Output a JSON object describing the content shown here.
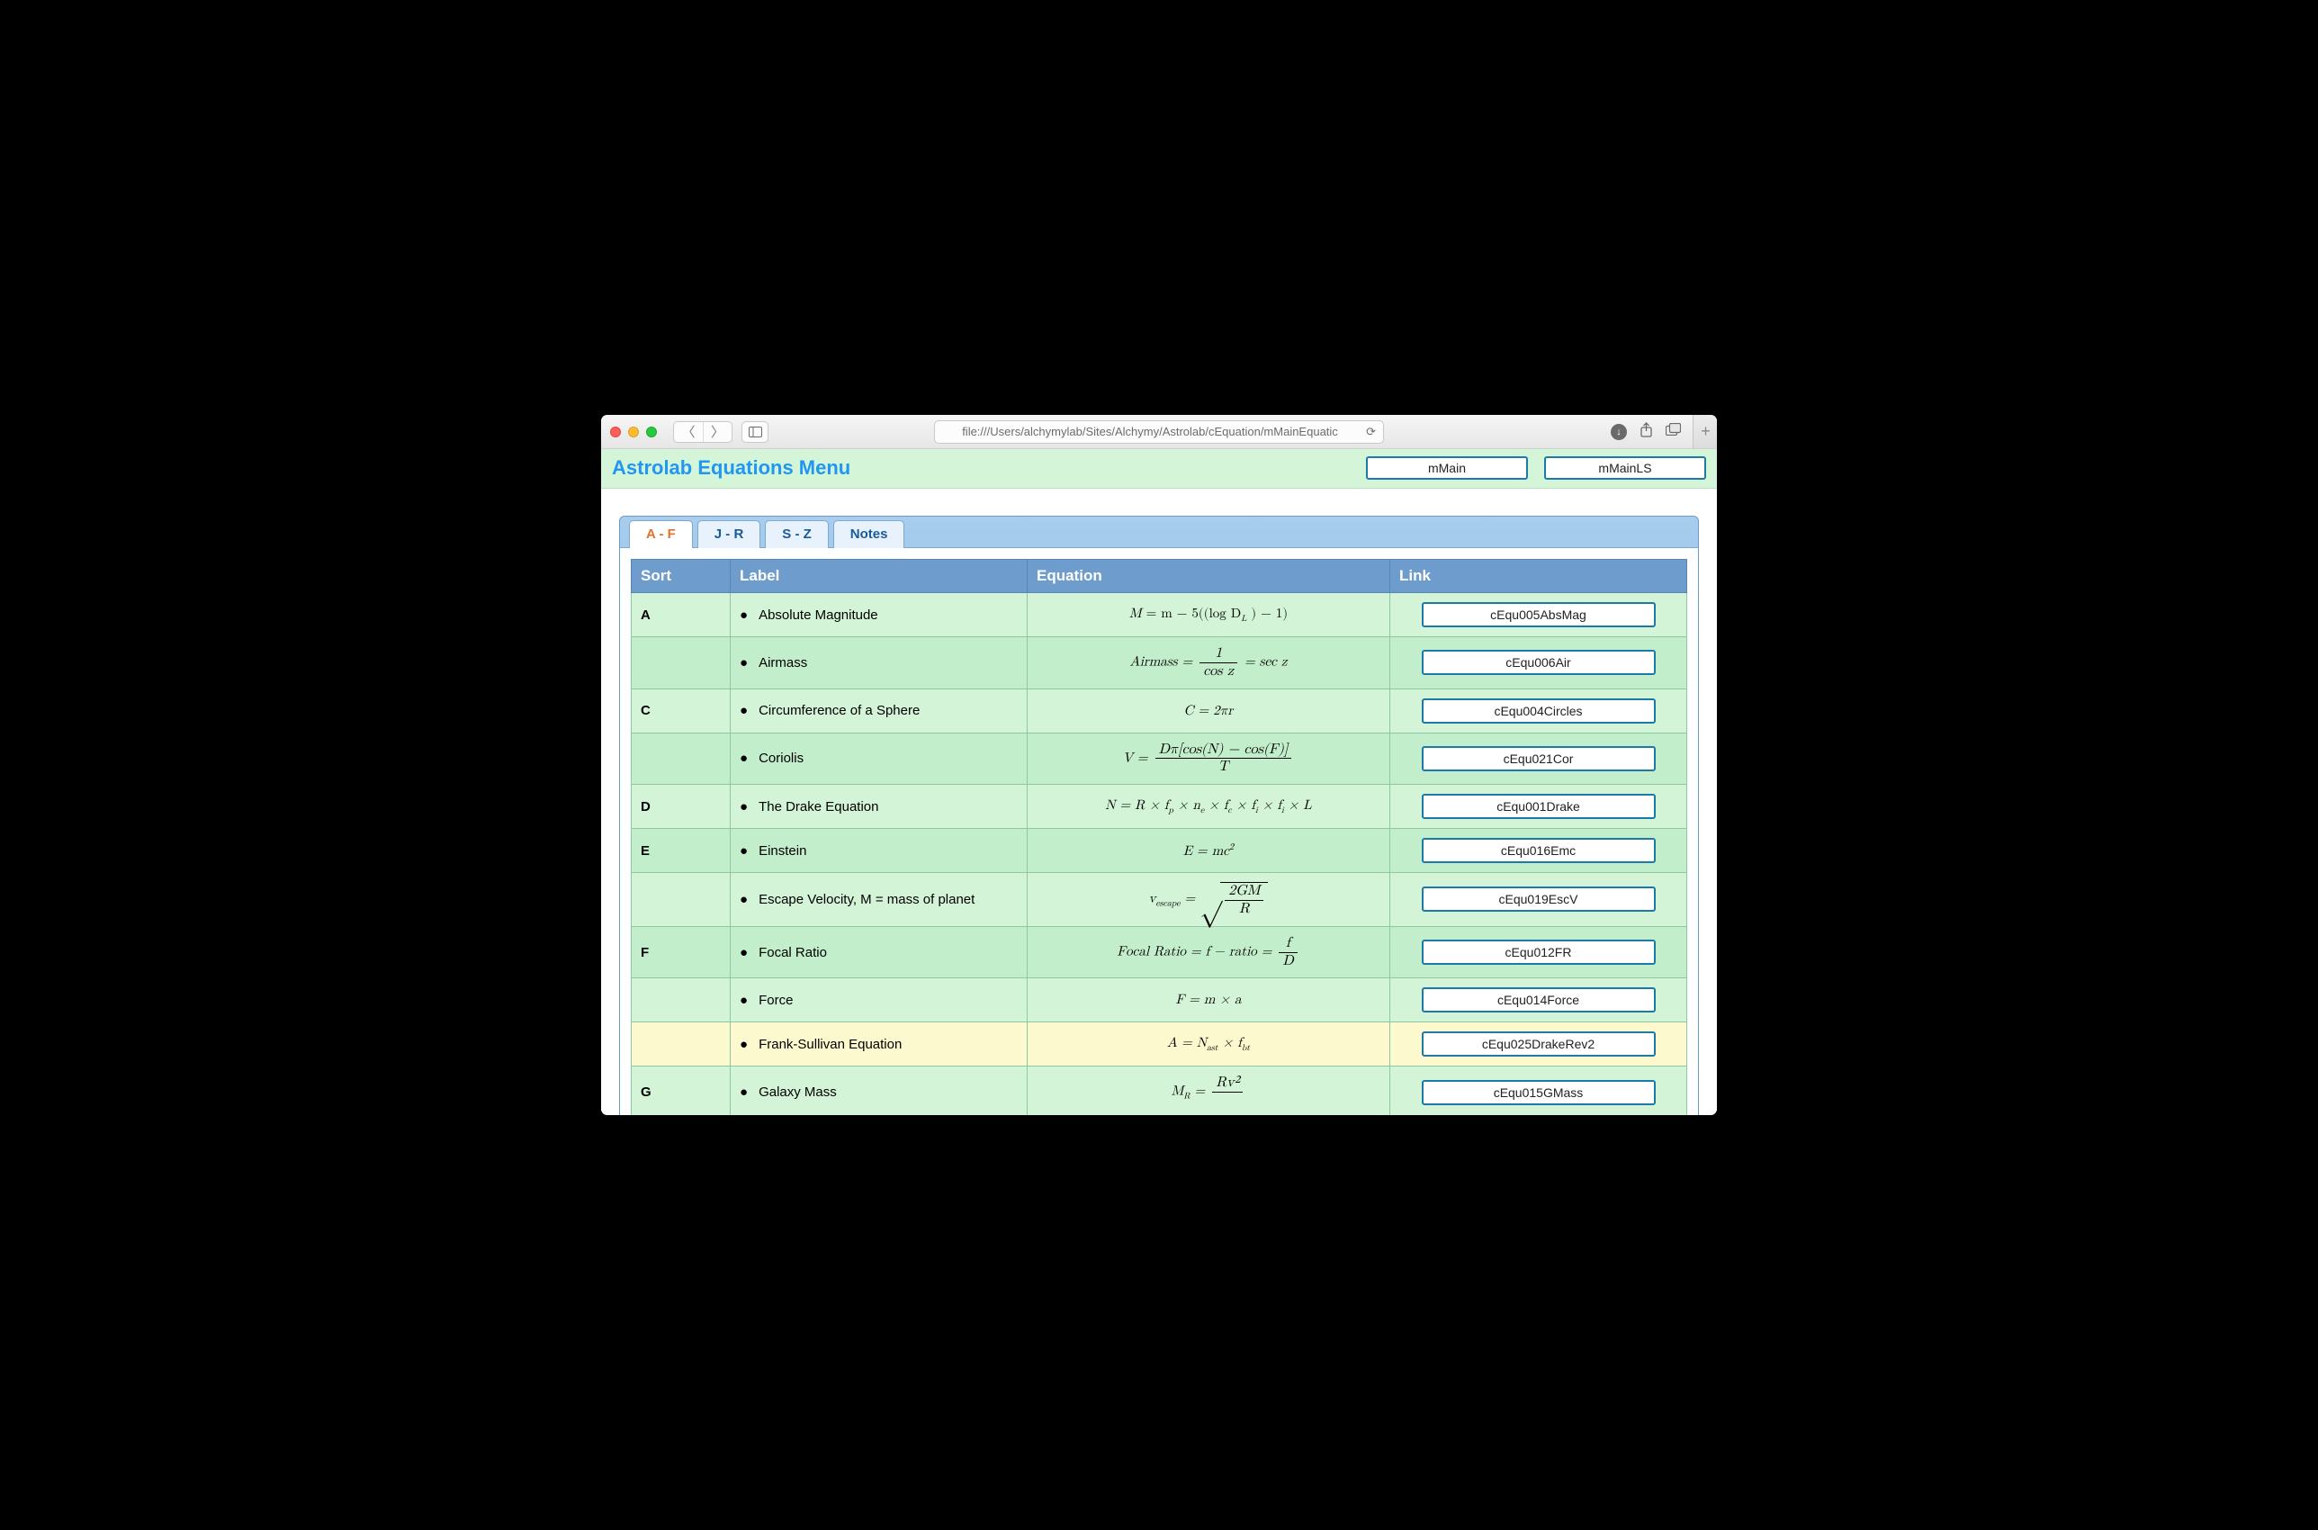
{
  "browser": {
    "url": "file:///Users/alchymylab/Sites/Alchymy/Astrolab/cEquation/mMainEquatic"
  },
  "page": {
    "title": "Astrolab Equations Menu",
    "header_buttons": [
      "mMain",
      "mMainLS"
    ]
  },
  "tabs": [
    "A - F",
    "J - R",
    "S - Z",
    "Notes"
  ],
  "active_tab": "A - F",
  "columns": [
    "Sort",
    "Label",
    "Equation",
    "Link"
  ],
  "rows": [
    {
      "sort": "A",
      "label": "Absolute Magnitude",
      "equation_parts": {
        "lhs": "M",
        "body": " = m − 5((log D",
        "sub": "L",
        "tail": " ) − 1)"
      },
      "link": "cEqu005AbsMag",
      "style": "even"
    },
    {
      "sort": "",
      "label": "Airmass",
      "equation_parts": {
        "text": "Airmass = ",
        "frac_num": "1",
        "frac_den": "cos z",
        "tail": " = sec z"
      },
      "link": "cEqu006Air",
      "style": "odd"
    },
    {
      "sort": "C",
      "label": "Circumference of a Sphere",
      "equation_parts": {
        "text": "C = 2πr"
      },
      "link": "cEqu004Circles",
      "style": "even"
    },
    {
      "sort": "",
      "label": "Coriolis",
      "equation_parts": {
        "text": "V = ",
        "frac_num": "Dπ[cos(N) − cos(F)]",
        "frac_den": "T"
      },
      "link": "cEqu021Cor",
      "style": "odd"
    },
    {
      "sort": "D",
      "label": "The Drake Equation",
      "equation_parts": {
        "text": "N = R × f",
        "subs": [
          "p",
          "e",
          "c",
          "i",
          "i"
        ],
        "inter": [
          " × n",
          " × f",
          " × f",
          " × f",
          " × L"
        ]
      },
      "link": "cEqu001Drake",
      "style": "even"
    },
    {
      "sort": "E",
      "label": "Einstein",
      "equation_parts": {
        "text": "E = mc",
        "sup": "2"
      },
      "link": "cEqu016Emc",
      "style": "odd"
    },
    {
      "sort": "",
      "label": "Escape Velocity, M = mass of planet",
      "equation_parts": {
        "pre": "v",
        "presub": "escape",
        "mid": " = ",
        "sqrt_num": "2GM",
        "sqrt_den": "R"
      },
      "link": "cEqu019EscV",
      "style": "even"
    },
    {
      "sort": "F",
      "label": "Focal Ratio",
      "equation_parts": {
        "text": "Focal Ratio = f − ratio = ",
        "frac_num": "f",
        "frac_den": "D"
      },
      "link": "cEqu012FR",
      "style": "odd"
    },
    {
      "sort": "",
      "label": "Force",
      "equation_parts": {
        "text": "F = m × a"
      },
      "link": "cEqu014Force",
      "style": "even"
    },
    {
      "sort": "",
      "label": "Frank-Sullivan Equation",
      "equation_parts": {
        "text": "A = N",
        "sub": "ast",
        "tail": " × f",
        "sub2": "bt"
      },
      "link": "cEqu025DrakeRev2",
      "style": "alt"
    },
    {
      "sort": "G",
      "label": "Galaxy Mass",
      "equation_parts": {
        "pre": "M",
        "presub": "R",
        "mid": " = ",
        "frac_num": "Rv²",
        "frac_den": ""
      },
      "link": "cEqu015GMass",
      "style": "even"
    }
  ]
}
